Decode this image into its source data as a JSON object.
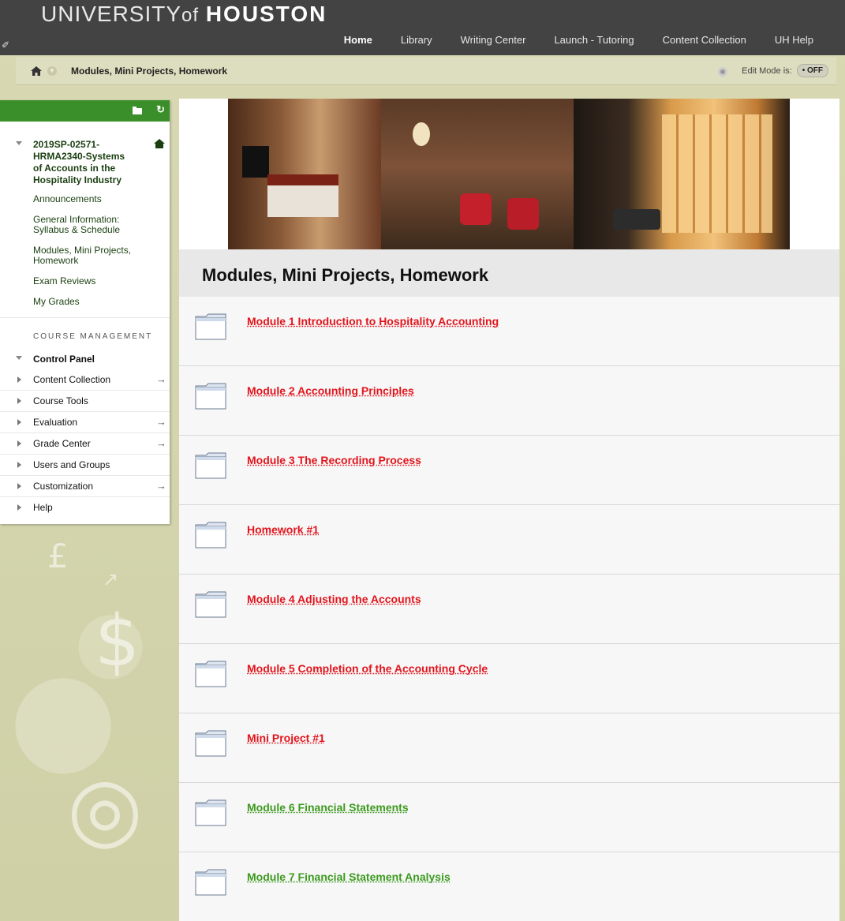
{
  "header": {
    "logo_university": "UNIVERSITY",
    "logo_of": "of",
    "logo_houston": "HOUSTON",
    "nav": [
      {
        "label": "Home",
        "active": true
      },
      {
        "label": "Library",
        "active": false
      },
      {
        "label": "Writing Center",
        "active": false
      },
      {
        "label": "Launch - Tutoring",
        "active": false
      },
      {
        "label": "Content Collection",
        "active": false
      },
      {
        "label": "UH Help",
        "active": false
      }
    ]
  },
  "breadcrumb": {
    "current": "Modules, Mini Projects, Homework",
    "edit_mode_label": "Edit Mode is:",
    "edit_mode_value": "OFF"
  },
  "sidebar": {
    "course_title": "2019SP-02571-HRMA2340-Systems of Accounts in the Hospitality Industry",
    "links": [
      "Announcements",
      "General Information: Syllabus & Schedule",
      "Modules, Mini Projects, Homework",
      "Exam Reviews",
      "My Grades"
    ],
    "management_title": "COURSE MANAGEMENT",
    "control_panel_label": "Control Panel",
    "control_panel_items": [
      {
        "label": "Content Collection",
        "has_arrow": true
      },
      {
        "label": "Course Tools",
        "has_arrow": false
      },
      {
        "label": "Evaluation",
        "has_arrow": true
      },
      {
        "label": "Grade Center",
        "has_arrow": true
      },
      {
        "label": "Users and Groups",
        "has_arrow": false
      },
      {
        "label": "Customization",
        "has_arrow": true
      },
      {
        "label": "Help",
        "has_arrow": false
      }
    ]
  },
  "main": {
    "page_title": "Modules, Mini Projects, Homework",
    "items": [
      {
        "title": "Module 1 Introduction to Hospitality Accounting",
        "color": "red"
      },
      {
        "title": "Module 2 Accounting Principles",
        "color": "red"
      },
      {
        "title": "Module 3 The Recording Process",
        "color": "red"
      },
      {
        "title": "Homework #1",
        "color": "red"
      },
      {
        "title": "Module 4 Adjusting the Accounts",
        "color": "red"
      },
      {
        "title": "Module 5 Completion of the Accounting Cycle",
        "color": "red"
      },
      {
        "title": "Mini Project #1",
        "color": "red"
      },
      {
        "title": "Module 6 Financial Statements",
        "color": "green"
      },
      {
        "title": "Module 7 Financial Statement Analysis",
        "color": "green"
      }
    ]
  },
  "colors": {
    "header_bg": "#434343",
    "menu_accent": "#3b8f2b",
    "link_red": "#e2141c",
    "link_green": "#3c9a1e"
  },
  "icons": [
    "pin-icon",
    "home-icon",
    "chevron-down-icon",
    "eye-icon",
    "folder-icon",
    "refresh-icon",
    "house-icon",
    "arrow-right-icon"
  ]
}
